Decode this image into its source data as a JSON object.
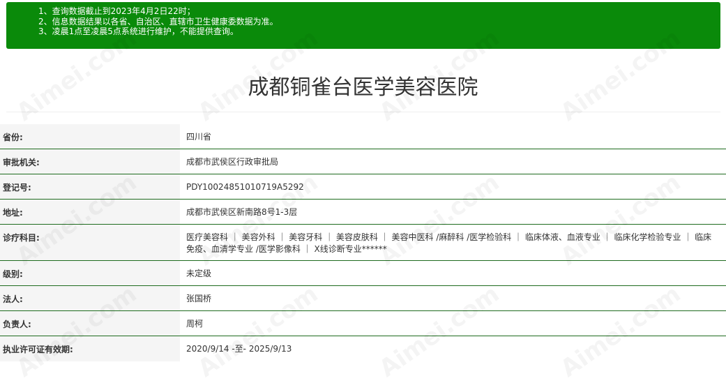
{
  "notice": {
    "lines": [
      "1、查询数据截止到2023年4月2日22时；",
      "2、信息数据结果以各省、自治区、直辖市卫生健康委数据为准。",
      "3、凌晨1点至凌晨5点系统进行维护，不能提供查询。"
    ]
  },
  "title": "成都铜雀台医学美容医院",
  "rows": [
    {
      "label": "省份:",
      "value": "四川省"
    },
    {
      "label": "审批机关:",
      "value": "成都市武侯区行政审批局"
    },
    {
      "label": "登记号:",
      "value": "PDY10024851010719A5292"
    },
    {
      "label": "地址:",
      "value": "成都市武侯区新南路8号1-3层"
    },
    {
      "label": "诊疗科目:",
      "value": "医疗美容科 ｜ 美容外科 ｜ 美容牙科 ｜ 美容皮肤科 ｜ 美容中医科 /麻醉科 /医学检验科 ｜ 临床体液、血液专业 ｜ 临床化学检验专业 ｜ 临床免疫、血清学专业 /医学影像科 ｜ X线诊断专业******"
    },
    {
      "label": "级别:",
      "value": "未定级"
    },
    {
      "label": "法人:",
      "value": "张国桥"
    },
    {
      "label": "负责人:",
      "value": "周柯"
    },
    {
      "label": "执业许可证有效期:",
      "value": "2020/9/14 -至- 2025/9/13"
    }
  ],
  "watermark": "Aimei.com"
}
